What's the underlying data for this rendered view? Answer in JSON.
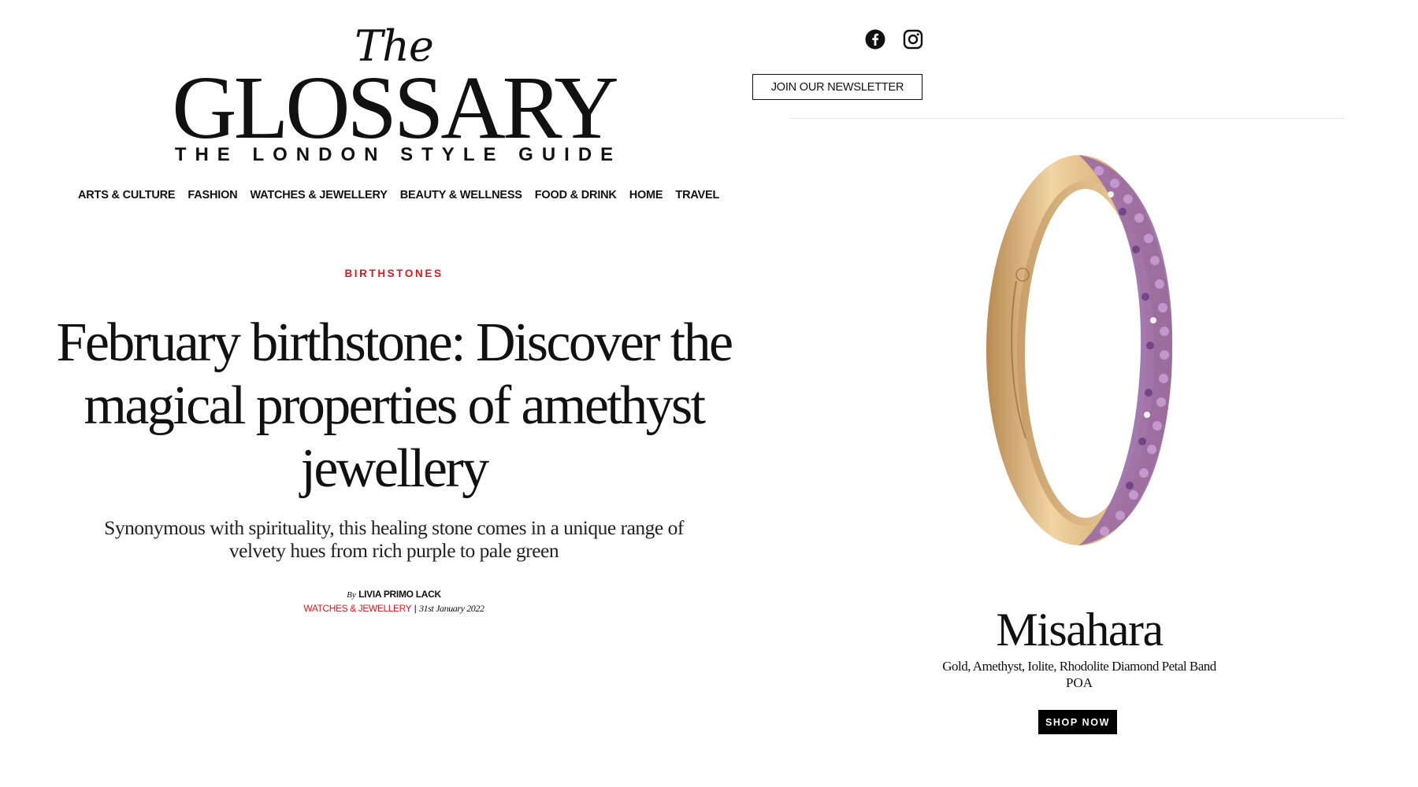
{
  "masthead": {
    "the": "The",
    "name": "GLOSSARY",
    "tagline": "THE LONDON STYLE GUIDE"
  },
  "nav": {
    "items": [
      {
        "label": "ARTS & CULTURE"
      },
      {
        "label": "FASHION"
      },
      {
        "label": "WATCHES & JEWELLERY"
      },
      {
        "label": "BEAUTY & WELLNESS"
      },
      {
        "label": "FOOD & DRINK"
      },
      {
        "label": "HOME"
      },
      {
        "label": "TRAVEL"
      }
    ]
  },
  "article": {
    "category": "BIRTHSTONES",
    "headline": "February birthstone: Discover the magical properties of amethyst jewellery",
    "standfirst": "Synonymous with spirituality, this healing stone comes in a unique range of velvety hues from rich purple to pale green",
    "by": "By",
    "author": "LIVIA PRIMO LACK",
    "section": "WATCHES & JEWELLERY",
    "separator": " | ",
    "date": "31st January 2022"
  },
  "header_right": {
    "social": [
      {
        "icon": "facebook-icon"
      },
      {
        "icon": "instagram-icon"
      }
    ],
    "newsletter_label": "JOIN OUR NEWSLETTER"
  },
  "ad": {
    "image_icon": "ring-image",
    "brand": "Misahara",
    "product": "Gold, Amethyst, Iolite, Rhodolite Diamond Petal Band",
    "price": "POA",
    "cta": "SHOP NOW"
  },
  "colors": {
    "accent": "#e3161b",
    "text": "#111111",
    "gold": "#d9b27c",
    "amethyst": "#8e5aa8"
  }
}
